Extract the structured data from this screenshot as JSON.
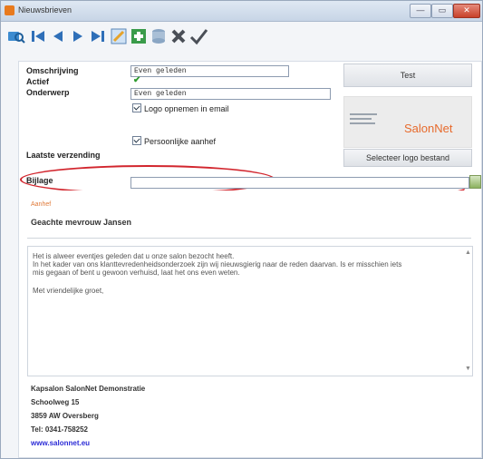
{
  "window": {
    "title": "Nieuwsbrieven",
    "buttons": {
      "minimize": "—",
      "maximize": "▭",
      "close": "✕"
    }
  },
  "toolbar": {
    "items": [
      {
        "icon": "search-icon"
      },
      {
        "icon": "first-record-icon"
      },
      {
        "icon": "previous-record-icon"
      },
      {
        "icon": "next-record-icon"
      },
      {
        "icon": "last-record-icon"
      },
      {
        "icon": "edit-icon"
      },
      {
        "icon": "add-icon"
      },
      {
        "icon": "database-icon"
      },
      {
        "icon": "delete-icon"
      },
      {
        "icon": "confirm-icon"
      }
    ]
  },
  "form": {
    "omschrijving_label": "Omschrijving",
    "omschrijving_value": "Even geleden",
    "actief_label": "Actief",
    "actief_check": "✔",
    "onderwerp_label": "Onderwerp",
    "onderwerp_value": "Even geleden",
    "logo_checkbox_label": "Logo opnemen in email",
    "persoonlijk_checkbox_label": "Persoonlijke aanhef",
    "laatste_label": "Laatste verzending",
    "bijlage_label": "Bijlage",
    "bijlage_value": ""
  },
  "side": {
    "test_button": "Test",
    "logo_text": "SalonNet",
    "select_logo_button": "Selecteer logo bestand"
  },
  "message": {
    "small_text": "Aanhef",
    "salutation": "Geachte mevrouw Jansen",
    "body_lines": [
      "Het is alweer eventjes geleden dat u onze salon bezocht heeft.",
      "In het kader van ons klanttevredenheidsonderzoek zijn wij nieuwsgierig naar de reden daarvan. Is er misschien iets",
      "mis gegaan of bent u gewoon verhuisd, laat het ons even weten.",
      "Met vriendelijke groet,"
    ],
    "signature": [
      "Kapsalon SalonNet Demonstratie",
      "Schoolweg 15",
      "3859 AW   Oversberg",
      "Tel: 0341-758252"
    ],
    "website": "www.salonnet.eu"
  },
  "colors": {
    "annotation_red": "#d2262e",
    "brand_orange": "#e76a2c",
    "link_blue": "#2b2bd6"
  }
}
